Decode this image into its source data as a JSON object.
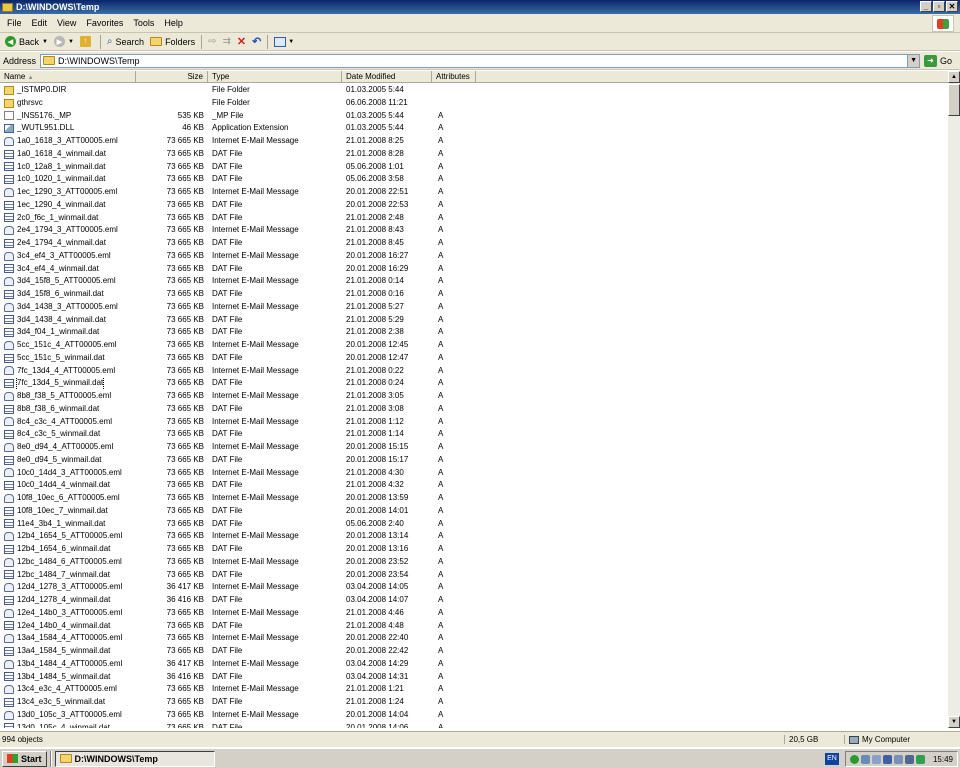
{
  "window": {
    "title": "D:\\WINDOWS\\Temp"
  },
  "menu": [
    "File",
    "Edit",
    "View",
    "Favorites",
    "Tools",
    "Help"
  ],
  "toolbar": {
    "back": "Back",
    "search": "Search",
    "folders": "Folders"
  },
  "address": {
    "label": "Address",
    "path": "D:\\WINDOWS\\Temp",
    "go": "Go"
  },
  "columns": {
    "name": "Name",
    "size": "Size",
    "type": "Type",
    "date": "Date Modified",
    "attr": "Attributes"
  },
  "rows": [
    {
      "icon": "folder",
      "name": "_ISTMP0.DIR",
      "size": "",
      "type": "File Folder",
      "date": "01.03.2005 5:44",
      "attr": ""
    },
    {
      "icon": "folder",
      "name": "gthrsvc",
      "size": "",
      "type": "File Folder",
      "date": "06.06.2008 11:21",
      "attr": ""
    },
    {
      "icon": "mp",
      "name": "_INS5176._MP",
      "size": "535 KB",
      "type": "_MP File",
      "date": "01.03.2005 5:44",
      "attr": "A"
    },
    {
      "icon": "dll",
      "name": "_WUTL951.DLL",
      "size": "46 KB",
      "type": "Application Extension",
      "date": "01.03.2005 5:44",
      "attr": "A"
    },
    {
      "icon": "eml",
      "name": "1a0_1618_3_ATT00005.eml",
      "size": "73 665 KB",
      "type": "Internet E-Mail Message",
      "date": "21.01.2008 8:25",
      "attr": "A"
    },
    {
      "icon": "dat",
      "name": "1a0_1618_4_winmail.dat",
      "size": "73 665 KB",
      "type": "DAT File",
      "date": "21.01.2008 8:28",
      "attr": "A"
    },
    {
      "icon": "dat",
      "name": "1c0_12a8_1_winmail.dat",
      "size": "73 665 KB",
      "type": "DAT File",
      "date": "05.06.2008 1:01",
      "attr": "A"
    },
    {
      "icon": "dat",
      "name": "1c0_1020_1_winmail.dat",
      "size": "73 665 KB",
      "type": "DAT File",
      "date": "05.06.2008 3:58",
      "attr": "A"
    },
    {
      "icon": "eml",
      "name": "1ec_1290_3_ATT00005.eml",
      "size": "73 665 KB",
      "type": "Internet E-Mail Message",
      "date": "20.01.2008 22:51",
      "attr": "A"
    },
    {
      "icon": "dat",
      "name": "1ec_1290_4_winmail.dat",
      "size": "73 665 KB",
      "type": "DAT File",
      "date": "20.01.2008 22:53",
      "attr": "A"
    },
    {
      "icon": "dat",
      "name": "2c0_f6c_1_winmail.dat",
      "size": "73 665 KB",
      "type": "DAT File",
      "date": "21.01.2008 2:48",
      "attr": "A"
    },
    {
      "icon": "eml",
      "name": "2e4_1794_3_ATT00005.eml",
      "size": "73 665 KB",
      "type": "Internet E-Mail Message",
      "date": "21.01.2008 8:43",
      "attr": "A"
    },
    {
      "icon": "dat",
      "name": "2e4_1794_4_winmail.dat",
      "size": "73 665 KB",
      "type": "DAT File",
      "date": "21.01.2008 8:45",
      "attr": "A"
    },
    {
      "icon": "eml",
      "name": "3c4_ef4_3_ATT00005.eml",
      "size": "73 665 KB",
      "type": "Internet E-Mail Message",
      "date": "20.01.2008 16:27",
      "attr": "A"
    },
    {
      "icon": "dat",
      "name": "3c4_ef4_4_winmail.dat",
      "size": "73 665 KB",
      "type": "DAT File",
      "date": "20.01.2008 16:29",
      "attr": "A"
    },
    {
      "icon": "eml",
      "name": "3d4_15f8_5_ATT00005.eml",
      "size": "73 665 KB",
      "type": "Internet E-Mail Message",
      "date": "21.01.2008 0:14",
      "attr": "A"
    },
    {
      "icon": "dat",
      "name": "3d4_15f8_6_winmail.dat",
      "size": "73 665 KB",
      "type": "DAT File",
      "date": "21.01.2008 0:16",
      "attr": "A"
    },
    {
      "icon": "eml",
      "name": "3d4_1438_3_ATT00005.eml",
      "size": "73 665 KB",
      "type": "Internet E-Mail Message",
      "date": "21.01.2008 5:27",
      "attr": "A"
    },
    {
      "icon": "dat",
      "name": "3d4_1438_4_winmail.dat",
      "size": "73 665 KB",
      "type": "DAT File",
      "date": "21.01.2008 5:29",
      "attr": "A"
    },
    {
      "icon": "dat",
      "name": "3d4_f04_1_winmail.dat",
      "size": "73 665 KB",
      "type": "DAT File",
      "date": "21.01.2008 2:38",
      "attr": "A"
    },
    {
      "icon": "eml",
      "name": "5cc_151c_4_ATT00005.eml",
      "size": "73 665 KB",
      "type": "Internet E-Mail Message",
      "date": "20.01.2008 12:45",
      "attr": "A"
    },
    {
      "icon": "dat",
      "name": "5cc_151c_5_winmail.dat",
      "size": "73 665 KB",
      "type": "DAT File",
      "date": "20.01.2008 12:47",
      "attr": "A"
    },
    {
      "icon": "eml",
      "name": "7fc_13d4_4_ATT00005.eml",
      "size": "73 665 KB",
      "type": "Internet E-Mail Message",
      "date": "21.01.2008 0:22",
      "attr": "A"
    },
    {
      "icon": "dat",
      "name": "7fc_13d4_5_winmail.dat",
      "size": "73 665 KB",
      "type": "DAT File",
      "date": "21.01.2008 0:24",
      "attr": "A",
      "selected": true
    },
    {
      "icon": "eml",
      "name": "8b8_f38_5_ATT00005.eml",
      "size": "73 665 KB",
      "type": "Internet E-Mail Message",
      "date": "21.01.2008 3:05",
      "attr": "A"
    },
    {
      "icon": "dat",
      "name": "8b8_f38_6_winmail.dat",
      "size": "73 665 KB",
      "type": "DAT File",
      "date": "21.01.2008 3:08",
      "attr": "A"
    },
    {
      "icon": "eml",
      "name": "8c4_c3c_4_ATT00005.eml",
      "size": "73 665 KB",
      "type": "Internet E-Mail Message",
      "date": "21.01.2008 1:12",
      "attr": "A"
    },
    {
      "icon": "dat",
      "name": "8c4_c3c_5_winmail.dat",
      "size": "73 665 KB",
      "type": "DAT File",
      "date": "21.01.2008 1:14",
      "attr": "A"
    },
    {
      "icon": "eml",
      "name": "8e0_d94_4_ATT00005.eml",
      "size": "73 665 KB",
      "type": "Internet E-Mail Message",
      "date": "20.01.2008 15:15",
      "attr": "A"
    },
    {
      "icon": "dat",
      "name": "8e0_d94_5_winmail.dat",
      "size": "73 665 KB",
      "type": "DAT File",
      "date": "20.01.2008 15:17",
      "attr": "A"
    },
    {
      "icon": "eml",
      "name": "10c0_14d4_3_ATT00005.eml",
      "size": "73 665 KB",
      "type": "Internet E-Mail Message",
      "date": "21.01.2008 4:30",
      "attr": "A"
    },
    {
      "icon": "dat",
      "name": "10c0_14d4_4_winmail.dat",
      "size": "73 665 KB",
      "type": "DAT File",
      "date": "21.01.2008 4:32",
      "attr": "A"
    },
    {
      "icon": "eml",
      "name": "10f8_10ec_6_ATT00005.eml",
      "size": "73 665 KB",
      "type": "Internet E-Mail Message",
      "date": "20.01.2008 13:59",
      "attr": "A"
    },
    {
      "icon": "dat",
      "name": "10f8_10ec_7_winmail.dat",
      "size": "73 665 KB",
      "type": "DAT File",
      "date": "20.01.2008 14:01",
      "attr": "A"
    },
    {
      "icon": "dat",
      "name": "11e4_3b4_1_winmail.dat",
      "size": "73 665 KB",
      "type": "DAT File",
      "date": "05.06.2008 2:40",
      "attr": "A"
    },
    {
      "icon": "eml",
      "name": "12b4_1654_5_ATT00005.eml",
      "size": "73 665 KB",
      "type": "Internet E-Mail Message",
      "date": "20.01.2008 13:14",
      "attr": "A"
    },
    {
      "icon": "dat",
      "name": "12b4_1654_6_winmail.dat",
      "size": "73 665 KB",
      "type": "DAT File",
      "date": "20.01.2008 13:16",
      "attr": "A"
    },
    {
      "icon": "eml",
      "name": "12bc_1484_6_ATT00005.eml",
      "size": "73 665 KB",
      "type": "Internet E-Mail Message",
      "date": "20.01.2008 23:52",
      "attr": "A"
    },
    {
      "icon": "dat",
      "name": "12bc_1484_7_winmail.dat",
      "size": "73 665 KB",
      "type": "DAT File",
      "date": "20.01.2008 23:54",
      "attr": "A"
    },
    {
      "icon": "eml",
      "name": "12d4_1278_3_ATT00005.eml",
      "size": "36 417 KB",
      "type": "Internet E-Mail Message",
      "date": "03.04.2008 14:05",
      "attr": "A"
    },
    {
      "icon": "dat",
      "name": "12d4_1278_4_winmail.dat",
      "size": "36 416 KB",
      "type": "DAT File",
      "date": "03.04.2008 14:07",
      "attr": "A"
    },
    {
      "icon": "eml",
      "name": "12e4_14b0_3_ATT00005.eml",
      "size": "73 665 KB",
      "type": "Internet E-Mail Message",
      "date": "21.01.2008 4:46",
      "attr": "A"
    },
    {
      "icon": "dat",
      "name": "12e4_14b0_4_winmail.dat",
      "size": "73 665 KB",
      "type": "DAT File",
      "date": "21.01.2008 4:48",
      "attr": "A"
    },
    {
      "icon": "eml",
      "name": "13a4_1584_4_ATT00005.eml",
      "size": "73 665 KB",
      "type": "Internet E-Mail Message",
      "date": "20.01.2008 22:40",
      "attr": "A"
    },
    {
      "icon": "dat",
      "name": "13a4_1584_5_winmail.dat",
      "size": "73 665 KB",
      "type": "DAT File",
      "date": "20.01.2008 22:42",
      "attr": "A"
    },
    {
      "icon": "eml",
      "name": "13b4_1484_4_ATT00005.eml",
      "size": "36 417 KB",
      "type": "Internet E-Mail Message",
      "date": "03.04.2008 14:29",
      "attr": "A"
    },
    {
      "icon": "dat",
      "name": "13b4_1484_5_winmail.dat",
      "size": "36 416 KB",
      "type": "DAT File",
      "date": "03.04.2008 14:31",
      "attr": "A"
    },
    {
      "icon": "eml",
      "name": "13c4_e3c_4_ATT00005.eml",
      "size": "73 665 KB",
      "type": "Internet E-Mail Message",
      "date": "21.01.2008 1:21",
      "attr": "A"
    },
    {
      "icon": "dat",
      "name": "13c4_e3c_5_winmail.dat",
      "size": "73 665 KB",
      "type": "DAT File",
      "date": "21.01.2008 1:24",
      "attr": "A"
    },
    {
      "icon": "eml",
      "name": "13d0_105c_3_ATT00005.eml",
      "size": "73 665 KB",
      "type": "Internet E-Mail Message",
      "date": "20.01.2008 14:04",
      "attr": "A"
    },
    {
      "icon": "dat",
      "name": "13d0_105c_4_winmail.dat",
      "size": "73 665 KB",
      "type": "DAT File",
      "date": "20.01.2008 14:06",
      "attr": "A"
    }
  ],
  "status": {
    "objects": "994 objects",
    "size": "20,5 GB",
    "zone": "My Computer"
  },
  "taskbar": {
    "start": "Start",
    "task": "D:\\WINDOWS\\Temp",
    "lang": "EN",
    "clock": "15:49"
  }
}
